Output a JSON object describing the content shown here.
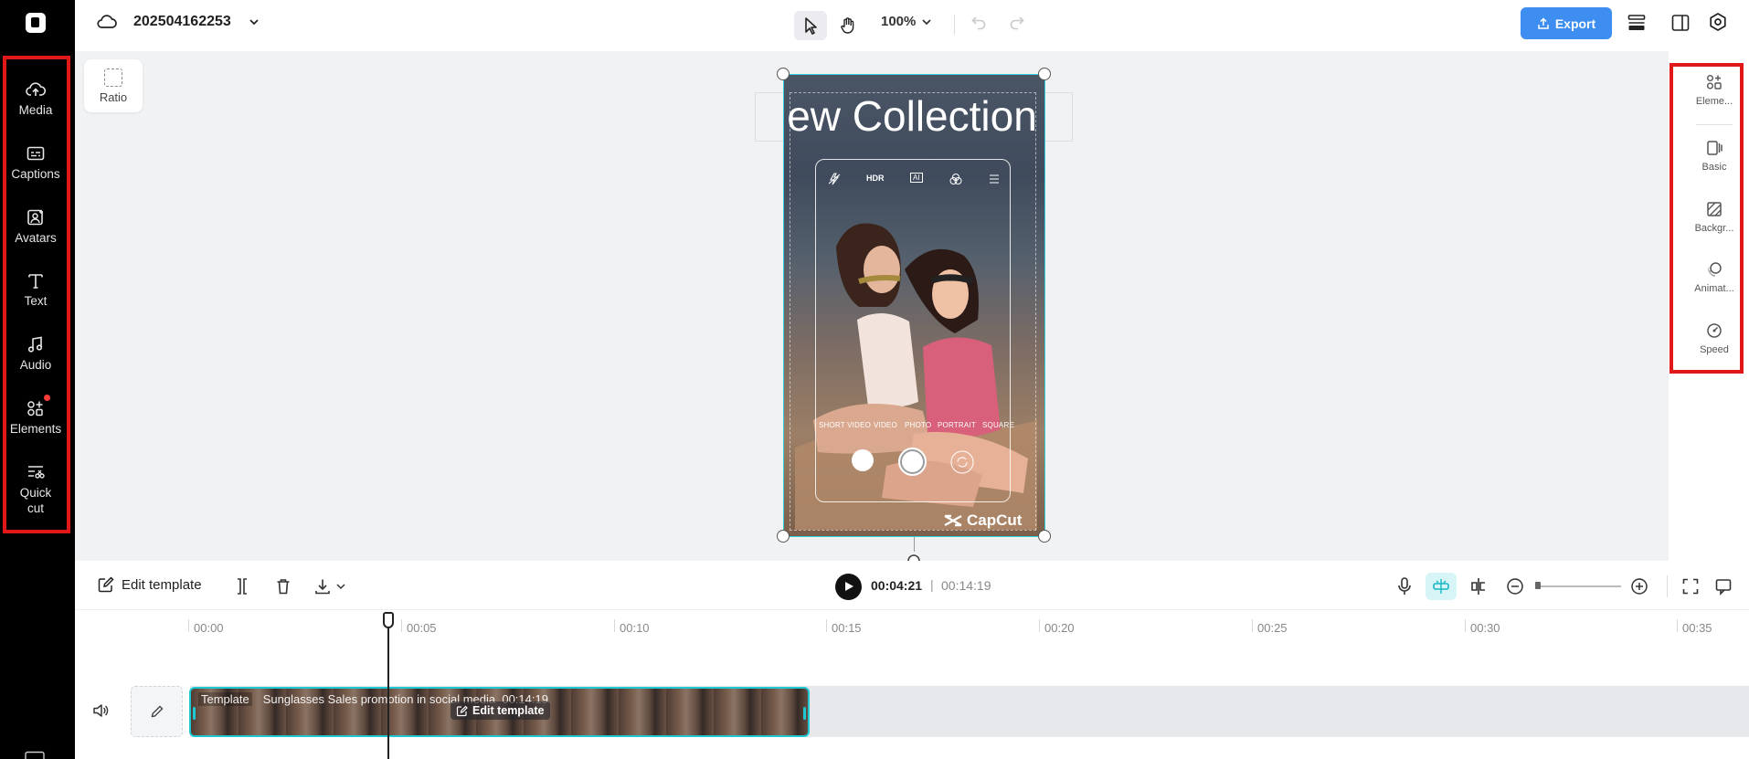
{
  "project": {
    "name": "202504162253"
  },
  "leftnav": {
    "items": [
      {
        "label": "Media",
        "icon": "cloud-upload-icon"
      },
      {
        "label": "Captions",
        "icon": "captions-icon"
      },
      {
        "label": "Avatars",
        "icon": "avatar-icon"
      },
      {
        "label": "Text",
        "icon": "text-icon"
      },
      {
        "label": "Audio",
        "icon": "music-note-icon"
      },
      {
        "label": "Elements",
        "icon": "elements-icon"
      },
      {
        "label": "Quick\ncut",
        "icon": "quick-cut-icon"
      }
    ]
  },
  "toolbar": {
    "zoom": "100%",
    "export_label": "Export"
  },
  "canvas": {
    "ratio_label": "Ratio",
    "title_text": "New Collection",
    "camera_modes": [
      "SHORT VIDEO",
      "VIDEO",
      "PHOTO",
      "PORTRAIT",
      "SQUARE"
    ],
    "camera_icons": [
      "HDR",
      "AI"
    ],
    "watermark": "CapCut"
  },
  "rightpanel": {
    "items": [
      {
        "label": "Eleme...",
        "icon": "elements-icon"
      },
      {
        "label": "Basic",
        "icon": "basic-icon"
      },
      {
        "label": "Backgr...",
        "icon": "background-icon"
      },
      {
        "label": "Animat...",
        "icon": "animation-icon"
      },
      {
        "label": "Speed",
        "icon": "speed-icon"
      }
    ]
  },
  "timeline": {
    "edit_template_label": "Edit template",
    "current_time": "00:04:21",
    "separator": "|",
    "total_time": "00:14:19",
    "ruler": [
      "00:00",
      "00:05",
      "00:10",
      "00:15",
      "00:20",
      "00:25",
      "00:30",
      "00:35"
    ],
    "clip": {
      "tag": "Template",
      "title": "Sunglasses Sales promotion in social media",
      "duration": "00:14:19",
      "badge": "Edit template"
    }
  },
  "colors": {
    "accent": "#3d8ef0",
    "selection": "#2fd0d8",
    "highlight": "#e01818"
  }
}
